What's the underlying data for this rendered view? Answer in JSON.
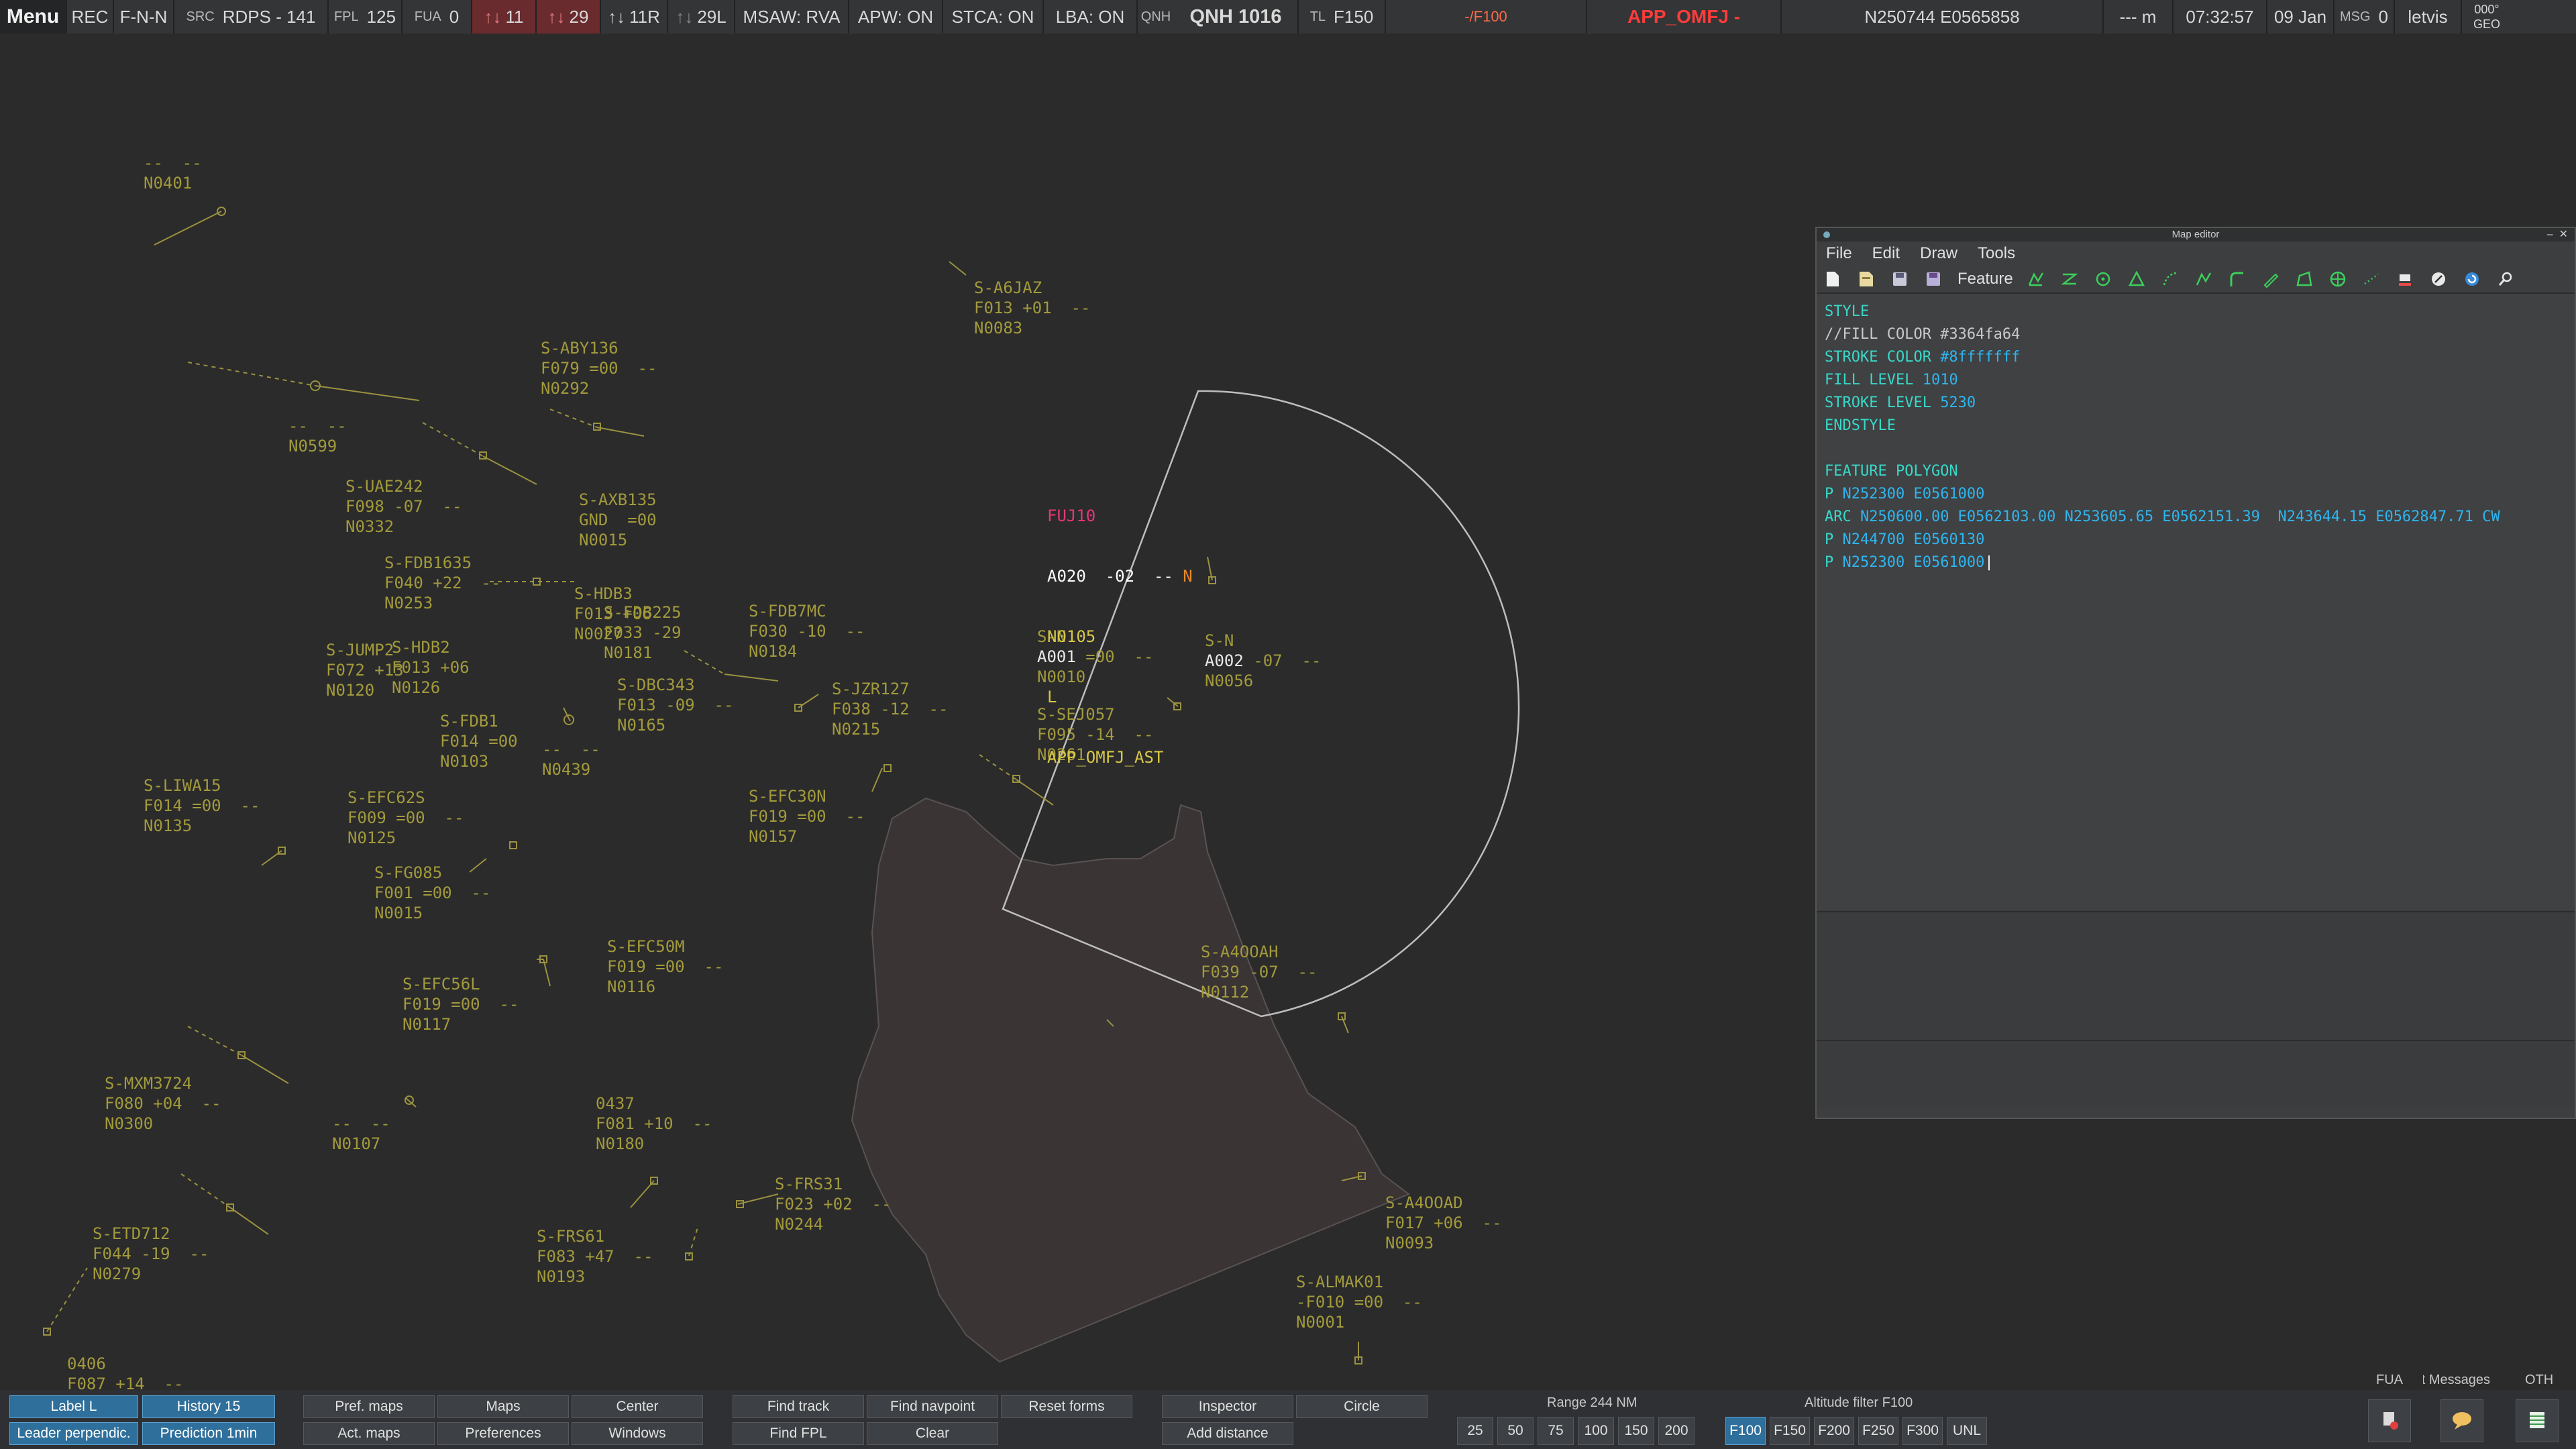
{
  "topbar": {
    "menu": "Menu",
    "rec": "REC",
    "fnn": "F-N-N",
    "src_label": "SRC",
    "src_value": "RDPS - 141",
    "fpl_label": "FPL",
    "fpl_value": "125",
    "fua_label": "FUA",
    "fua_value": "0",
    "cnt1": "11",
    "cnt2": "29",
    "cnt3": "11R",
    "cnt4": "29L",
    "msaw": "MSAW: RVA",
    "apw": "APW: ON",
    "stca": "STCA: ON",
    "lba": "LBA: ON",
    "qnh_label": "QNH",
    "qnh_value": "QNH 1016",
    "tl_label": "TL",
    "tl_value": "F150",
    "flrange": "-/F100",
    "sector": "APP_OMFJ -",
    "coords": "N250744 E0565858",
    "meters": "--- m",
    "time": "07:32:57",
    "date": "09 Jan",
    "msg_label": "MSG",
    "msg_value": "0",
    "user": "letvis",
    "geo_top": "000°",
    "geo_bot": "GEO"
  },
  "labels": [
    {
      "t": "--  --\nN0401"
    },
    {
      "t": "S-A6JAZ\nF013 +01  --\nN0083"
    },
    {
      "t": "S-ABY136\nF079 =00  --\nN0292"
    },
    {
      "t": "--  --\nN0599"
    },
    {
      "t": "S-UAE242\nF098 -07  --\nN0332"
    },
    {
      "t": "S-AXB135\nGND  =00\nN0015"
    },
    {
      "t": "S-FDB1635\nF040 +22  --\nN0253"
    },
    {
      "t": "S-HDB3\nF013 +06\nN0027"
    },
    {
      "t": "S-FDB7MC\nF030 -10  --\nN0184"
    },
    {
      "t": "S-JUMP2\nF072 +13\nN0120"
    },
    {
      "t": "S-HDB2\nF013 +06\nN0126"
    },
    {
      "t": "S-JZR127\nF038 -12  --\nN0215"
    },
    {
      "t": "S-FDB1\nF014 =00\nN0103"
    },
    {
      "t": "--  --\nN0439"
    },
    {
      "t": "S-LIWA15\nF014 =00  --\nN0135"
    },
    {
      "t": "S-EFC62S\nF009 =00  --\nN0125"
    },
    {
      "t": "S-EFC30N\nF019 =00  --\nN0157"
    },
    {
      "t": "S-FG085\nF001 =00  --\nN0015"
    },
    {
      "t": "S-EFC50M\nF019 =00  --\nN0116"
    },
    {
      "t": "S-EFC56L\nF019 =00  --\nN0117"
    },
    {
      "t": "S-MXM3724\nF080 +04  --\nN0300"
    },
    {
      "t": "--  --\nN0107"
    },
    {
      "t": "0437\nF081 +10  --\nN0180"
    },
    {
      "t": "S-FRS31\nF023 +02  --\nN0244"
    },
    {
      "t": "S-ETD712\nF044 -19  --\nN0279"
    },
    {
      "t": "S-FRS61\nF083 +47  --\nN0193"
    },
    {
      "t": "0406\nF087 +14  --"
    },
    {
      "t": "S-A4OOAH\nF039 -07  --\nN0112"
    },
    {
      "t": "S-A4OOAD\nF017 +06  --\nN0093"
    },
    {
      "t": "S-ALMAK01\n-F010 =00  --\nN0001"
    },
    {
      "t": "S-N\n\nN0010"
    },
    {
      "t": "S-N\n\nN0056"
    },
    {
      "t": "S-SEJ057\nF095 -14  --\nN0261"
    },
    {
      "t": "S-DBC343\nF013 -09  --\nN0165"
    },
    {
      "t": "S-FDB225\nF033 -29\nN0181"
    }
  ],
  "focus": {
    "callsign": "FUJ10",
    "line2": "A020  -02  --",
    "flag": "N",
    "line3": "N0105",
    "line4": "L",
    "line5": "APP_OMFJ_AST",
    "a001": "A001",
    "a001_rest": " =00  --",
    "a002": "A002",
    "a002_rest": " -07  --"
  },
  "editor": {
    "title": "Map editor",
    "menu": [
      "File",
      "Edit",
      "Draw",
      "Tools"
    ],
    "feature": "Feature",
    "code": {
      "l1": "STYLE",
      "l2": "//FILL COLOR #3364fa64",
      "l3k": "STROKE COLOR ",
      "l3v": "#8fffffff",
      "l4k": "FILL LEVEL ",
      "l4v": "1010",
      "l5k": "STROKE LEVEL ",
      "l5v": "5230",
      "l6": "ENDSTYLE",
      "l8": "FEATURE POLYGON",
      "l9k": "P ",
      "l9v": "N252300 E0561000",
      "l10k": "ARC ",
      "l10v": "N250600.00 E0562103.00 N253605.65 E0562151.39  N243644.15 E0562847.71 CW",
      "l11k": "P ",
      "l11v": "N244700 E0560130",
      "l12k": "P ",
      "l12v": "N252300 E0561000"
    }
  },
  "bottombar": {
    "label_l": "Label L",
    "history": "History 15",
    "leader": "Leader perpendic.",
    "prediction": "Prediction 1min",
    "pref_maps": "Pref. maps",
    "maps": "Maps",
    "center": "Center",
    "act_maps": "Act. maps",
    "preferences": "Preferences",
    "windows": "Windows",
    "find_track": "Find track",
    "find_navpoint": "Find navpoint",
    "reset_forms": "Reset forms",
    "find_fpl": "Find FPL",
    "clear": "Clear",
    "inspector": "Inspector",
    "circle": "Circle",
    "add_distance": "Add distance",
    "range_label": "Range 244 NM",
    "ranges": [
      "25",
      "50",
      "75",
      "100",
      "150",
      "200"
    ],
    "alt_label": "Altitude filter F100",
    "alts": [
      "F100",
      "F150",
      "F200",
      "F250",
      "F300",
      "UNL"
    ],
    "fua": "FUA",
    "text_messages": "Text Messages",
    "oth": "OTH"
  }
}
